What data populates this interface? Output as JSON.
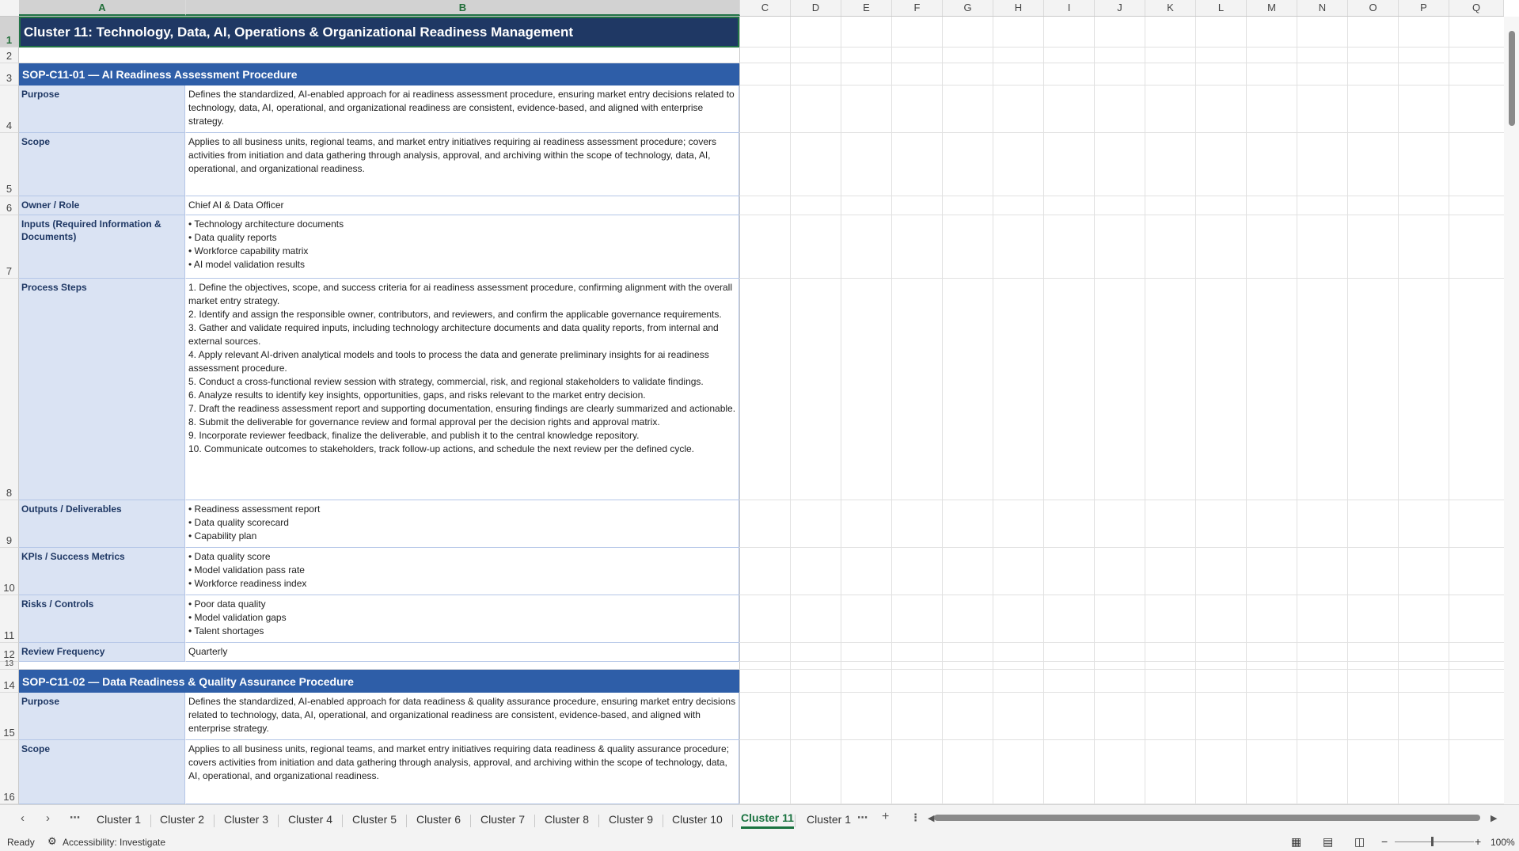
{
  "columns": [
    "A",
    "B",
    "C",
    "D",
    "E",
    "F",
    "G",
    "H",
    "I",
    "J",
    "K",
    "L",
    "M",
    "N",
    "O",
    "P",
    "Q"
  ],
  "rows": [
    "1",
    "2",
    "3",
    "4",
    "5",
    "6",
    "7",
    "8",
    "9",
    "10",
    "11",
    "12",
    "13",
    "14",
    "15",
    "16"
  ],
  "title": "Cluster 11: Technology, Data, AI, Operations & Organizational Readiness Management",
  "sections": [
    {
      "heading": "SOP-C11-01  —  AI Readiness Assessment Procedure",
      "fields": [
        {
          "label": "Purpose",
          "value": "Defines the standardized, AI-enabled approach for ai readiness assessment procedure, ensuring market entry decisions related to technology, data, AI, operational, and organizational readiness are consistent, evidence-based, and aligned with enterprise strategy."
        },
        {
          "label": "Scope",
          "value": "Applies to all business units, regional teams, and market entry initiatives requiring ai readiness assessment procedure; covers activities from initiation and data gathering through analysis, approval, and archiving within the scope of technology, data, AI, operational, and organizational readiness."
        },
        {
          "label": "Owner / Role",
          "value": "Chief AI & Data Officer"
        },
        {
          "label": "Inputs (Required Information & Documents)",
          "value": "• Technology architecture documents\n• Data quality reports\n• Workforce capability matrix\n• AI model validation results"
        },
        {
          "label": "Process Steps",
          "value": "1. Define the objectives, scope, and success criteria for ai readiness assessment procedure, confirming alignment with the overall market entry strategy.\n2. Identify and assign the responsible owner, contributors, and reviewers, and confirm the applicable governance requirements.\n3. Gather and validate required inputs, including technology architecture documents and data quality reports, from internal and external sources.\n4. Apply relevant AI-driven analytical models and tools to process the data and generate preliminary insights for ai readiness assessment procedure.\n5. Conduct a cross-functional review session with strategy, commercial, risk, and regional stakeholders to validate findings.\n6. Analyze results to identify key insights, opportunities, gaps, and risks relevant to the market entry decision.\n7. Draft the readiness assessment report and supporting documentation, ensuring findings are clearly summarized and actionable.\n8. Submit the deliverable for governance review and formal approval per the decision rights and approval matrix.\n9. Incorporate reviewer feedback, finalize the deliverable, and publish it to the central knowledge repository.\n10. Communicate outcomes to stakeholders, track follow-up actions, and schedule the next review per the defined cycle."
        },
        {
          "label": "Outputs / Deliverables",
          "value": "• Readiness assessment report\n• Data quality scorecard\n• Capability plan"
        },
        {
          "label": "KPIs / Success Metrics",
          "value": "• Data quality score\n• Model validation pass rate\n• Workforce readiness index"
        },
        {
          "label": "Risks / Controls",
          "value": "• Poor data quality\n• Model validation gaps\n• Talent shortages"
        },
        {
          "label": "Review Frequency",
          "value": "Quarterly"
        }
      ]
    },
    {
      "heading": "SOP-C11-02  —  Data Readiness & Quality Assurance Procedure",
      "fields": [
        {
          "label": "Purpose",
          "value": "Defines the standardized, AI-enabled approach for data readiness & quality assurance procedure, ensuring market entry decisions related to technology, data, AI, operational, and organizational readiness are consistent, evidence-based, and aligned with enterprise strategy."
        },
        {
          "label": "Scope",
          "value": "Applies to all business units, regional teams, and market entry initiatives requiring data readiness & quality assurance procedure; covers activities from initiation and data gathering through analysis, approval, and archiving within the scope of technology, data, AI, operational, and organizational readiness."
        }
      ]
    }
  ],
  "tabs": [
    "Cluster 1",
    "Cluster 2",
    "Cluster 3",
    "Cluster 4",
    "Cluster 5",
    "Cluster 6",
    "Cluster 7",
    "Cluster 8",
    "Cluster 9",
    "Cluster 10",
    "Cluster 11",
    "Cluster 1"
  ],
  "active_tab": "Cluster 11",
  "status": {
    "ready": "Ready",
    "accessibility": "Accessibility: Investigate",
    "zoom": "100%"
  },
  "colors": {
    "title_bg": "#1f3864",
    "section_bg": "#2e5ea8",
    "label_bg": "#dae3f3",
    "accent": "#217346"
  }
}
